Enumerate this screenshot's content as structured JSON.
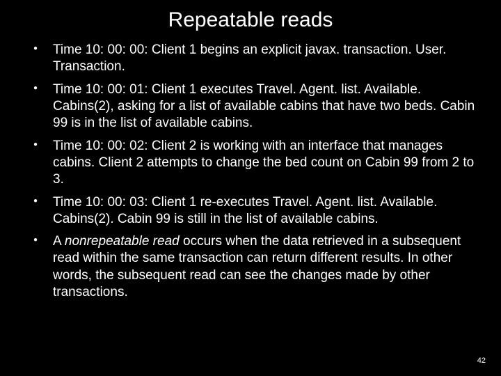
{
  "title": "Repeatable reads",
  "bullets": [
    {
      "text": "Time 10: 00: 00: Client 1 begins an explicit javax. transaction. User. Transaction."
    },
    {
      "text": "Time 10: 00: 01: Client 1 executes Travel. Agent. list. Available. Cabins(2), asking for a list of available cabins that have two beds. Cabin 99 is in the list of available cabins."
    },
    {
      "text": "Time 10: 00: 02: Client 2 is working with an interface that manages cabins. Client 2 attempts to change the bed count on Cabin 99 from 2 to 3."
    },
    {
      "text": "Time 10: 00: 03: Client 1 re-executes Travel. Agent. list. Available. Cabins(2). Cabin 99 is still in the list of available cabins."
    },
    {
      "italic_lead": "A ",
      "italic": "nonrepeatable read",
      "rest": " occurs when the data retrieved in a subsequent read within the same transaction can return different results. In other words, the subsequent read can see the changes made by other transactions."
    }
  ],
  "page_number": "42"
}
